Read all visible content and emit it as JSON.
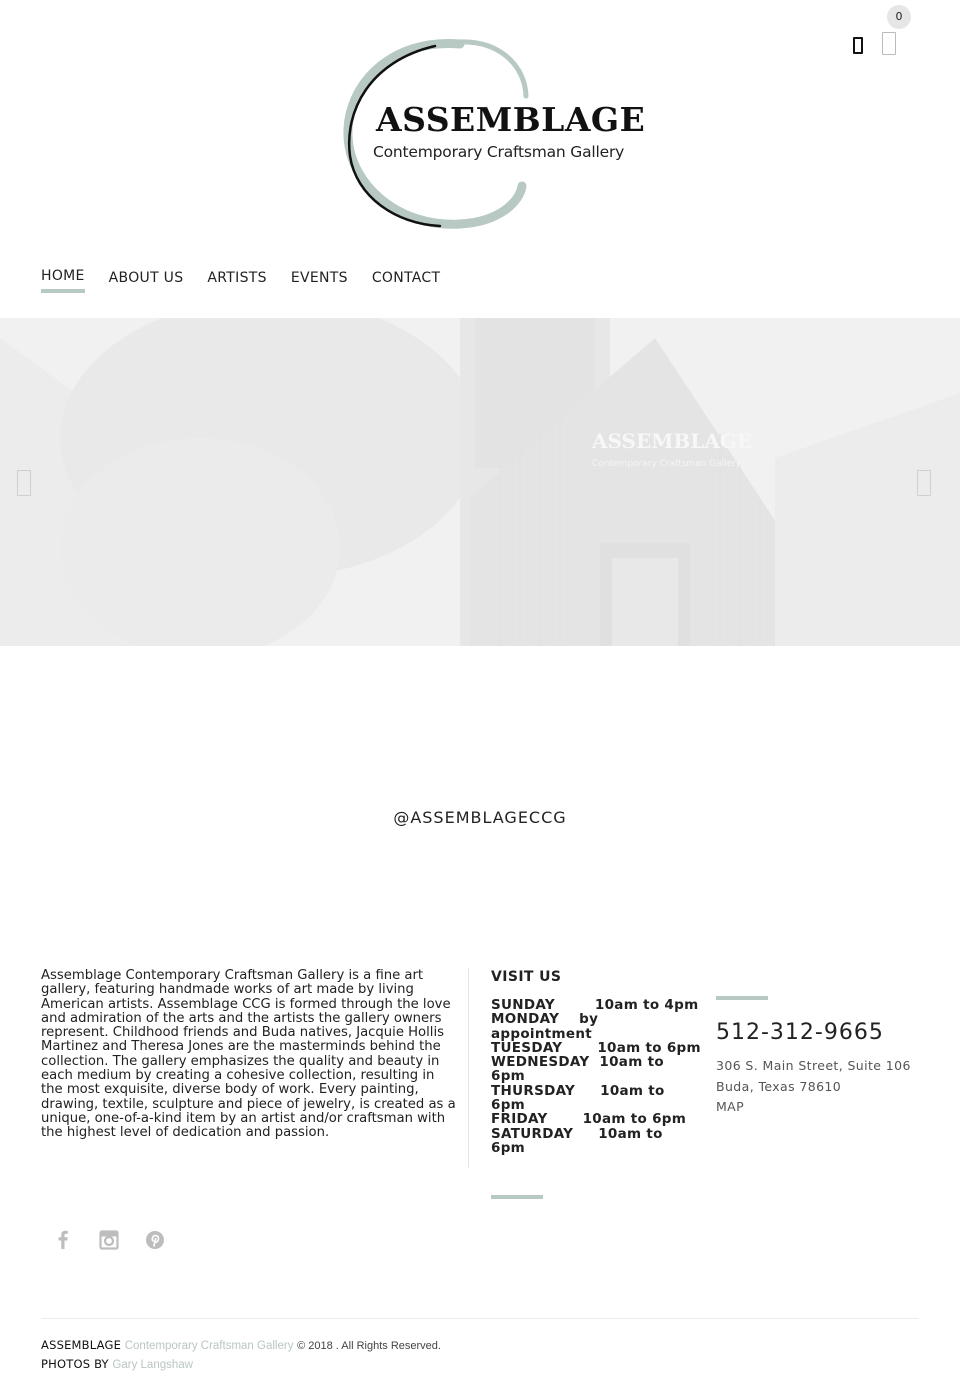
{
  "header": {
    "cart_count": "0",
    "icons": [
      "user-icon",
      "cart-icon"
    ]
  },
  "logo": {
    "title": "ASSEMBLAGE",
    "subtitle": "Contemporary Craftsman Gallery"
  },
  "nav": {
    "items": [
      {
        "label": "HOME",
        "active": true
      },
      {
        "label": "ABOUT US",
        "active": false
      },
      {
        "label": "ARTISTS",
        "active": false
      },
      {
        "label": "EVENTS",
        "active": false
      },
      {
        "label": "CONTACT",
        "active": false
      }
    ]
  },
  "hero": {
    "prev_icon": "arrow-left-icon",
    "next_icon": "arrow-right-icon",
    "sign_text": "ASSEMBLAGE",
    "sign_subtext": "Contemporary Craftsman Gallery"
  },
  "instagram": {
    "handle": "@ASSEMBLAGECCG"
  },
  "about": {
    "text": "Assemblage Contemporary Craftsman Gallery is a fine art gallery, featuring handmade works of art made by living American artists. Assemblage CCG is formed through the love and admiration of the arts and the artists the gallery owners represent. Childhood friends and Buda natives, Jacquie Hollis Martinez and Theresa Jones are the masterminds behind the collection. The gallery emphasizes the quality and beauty in each medium by creating a cohesive collection, resulting in the most exquisite, diverse body of work. Every painting, drawing, textile, sculpture and piece of jewelry, is created as a unique, one-of-a-kind item by an artist and/or craftsman with the highest level of dedication and passion."
  },
  "visit": {
    "title": "VISIT US",
    "hours": [
      {
        "day": "SUNDAY",
        "gap": "        ",
        "time": "10am to 4pm"
      },
      {
        "day": "MONDAY",
        "gap": "    ",
        "time": "by appointment"
      },
      {
        "day": "TUESDAY",
        "gap": "       ",
        "time": "10am to 6pm"
      },
      {
        "day": "WEDNESDAY",
        "gap": "  ",
        "time": "10am to 6pm"
      },
      {
        "day": "THURSDAY",
        "gap": "     ",
        "time": "10am to 6pm"
      },
      {
        "day": "FRIDAY",
        "gap": "       ",
        "time": "10am to 6pm"
      },
      {
        "day": "SATURDAY",
        "gap": "     ",
        "time": "10am to 6pm"
      }
    ]
  },
  "contact": {
    "phone": "512-312-9665",
    "address_line1": "306 S. Main Street, Suite 106",
    "address_line2": "Buda, Texas 78610",
    "map_label": "MAP"
  },
  "social": {
    "icons": [
      "facebook-icon",
      "instagram-icon",
      "pinterest-icon"
    ]
  },
  "footer": {
    "brand": "ASSEMBLAGE",
    "brand_tagline": "Contemporary Craftsman Gallery",
    "copyright": "© 2018 . All Rights Reserved.",
    "photos_label": "PHOTOS BY",
    "photographer": "Gary Langshaw"
  },
  "colors": {
    "accent": "#b7c9c2",
    "text": "#222222",
    "muted": "#555555",
    "light_link": "#b9c6c1"
  }
}
